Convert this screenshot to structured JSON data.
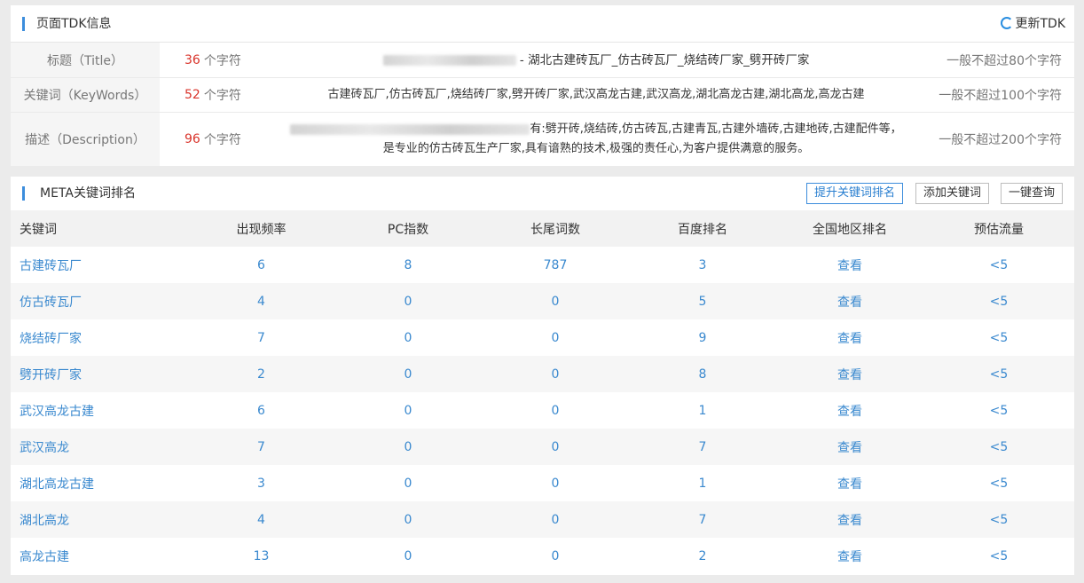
{
  "tdk": {
    "title": "页面TDK信息",
    "refresh_label": "更新TDK",
    "unit": "个字符",
    "rows": [
      {
        "label": "标题（Title）",
        "count": "36",
        "content_line1": " - 湖北古建砖瓦厂_仿古砖瓦厂_烧结砖厂家_劈开砖厂家",
        "content_line2": "",
        "limit": "一般不超过80个字符"
      },
      {
        "label": "关键词（KeyWords）",
        "count": "52",
        "content_line1": "古建砖瓦厂,仿古砖瓦厂,烧结砖厂家,劈开砖厂家,武汉高龙古建,武汉高龙,湖北高龙古建,湖北高龙,高龙古建",
        "content_line2": "",
        "limit": "一般不超过100个字符"
      },
      {
        "label": "描述（Description）",
        "count": "96",
        "content_line1": "有:劈开砖,烧结砖,仿古砖瓦,古建青瓦,古建外墙砖,古建地砖,古建配件等，",
        "content_line2": "是专业的仿古砖瓦生产厂家,具有谙熟的技术,极强的责任心,为客户提供满意的服务。",
        "limit": "一般不超过200个字符"
      }
    ]
  },
  "meta": {
    "title": "META关键词排名",
    "buttons": {
      "boost": "提升关键词排名",
      "add": "添加关键词",
      "query": "一键查询"
    },
    "columns": [
      "关键词",
      "出现频率",
      "PC指数",
      "长尾词数",
      "百度排名",
      "全国地区排名",
      "预估流量"
    ],
    "rows": [
      {
        "keyword": "古建砖瓦厂",
        "freq": "6",
        "pc": "8",
        "longtail": "787",
        "baidu": "3",
        "region": "查看",
        "traffic": "<5"
      },
      {
        "keyword": "仿古砖瓦厂",
        "freq": "4",
        "pc": "0",
        "longtail": "0",
        "baidu": "5",
        "region": "查看",
        "traffic": "<5"
      },
      {
        "keyword": "烧结砖厂家",
        "freq": "7",
        "pc": "0",
        "longtail": "0",
        "baidu": "9",
        "region": "查看",
        "traffic": "<5"
      },
      {
        "keyword": "劈开砖厂家",
        "freq": "2",
        "pc": "0",
        "longtail": "0",
        "baidu": "8",
        "region": "查看",
        "traffic": "<5"
      },
      {
        "keyword": "武汉高龙古建",
        "freq": "6",
        "pc": "0",
        "longtail": "0",
        "baidu": "1",
        "region": "查看",
        "traffic": "<5"
      },
      {
        "keyword": "武汉高龙",
        "freq": "7",
        "pc": "0",
        "longtail": "0",
        "baidu": "7",
        "region": "查看",
        "traffic": "<5"
      },
      {
        "keyword": "湖北高龙古建",
        "freq": "3",
        "pc": "0",
        "longtail": "0",
        "baidu": "1",
        "region": "查看",
        "traffic": "<5"
      },
      {
        "keyword": "湖北高龙",
        "freq": "4",
        "pc": "0",
        "longtail": "0",
        "baidu": "7",
        "region": "查看",
        "traffic": "<5"
      },
      {
        "keyword": "高龙古建",
        "freq": "13",
        "pc": "0",
        "longtail": "0",
        "baidu": "2",
        "region": "查看",
        "traffic": "<5"
      }
    ]
  },
  "colors": {
    "accent": "#3c8ddc",
    "count_red": "#d9342b",
    "link_blue": "#3a89cf"
  }
}
